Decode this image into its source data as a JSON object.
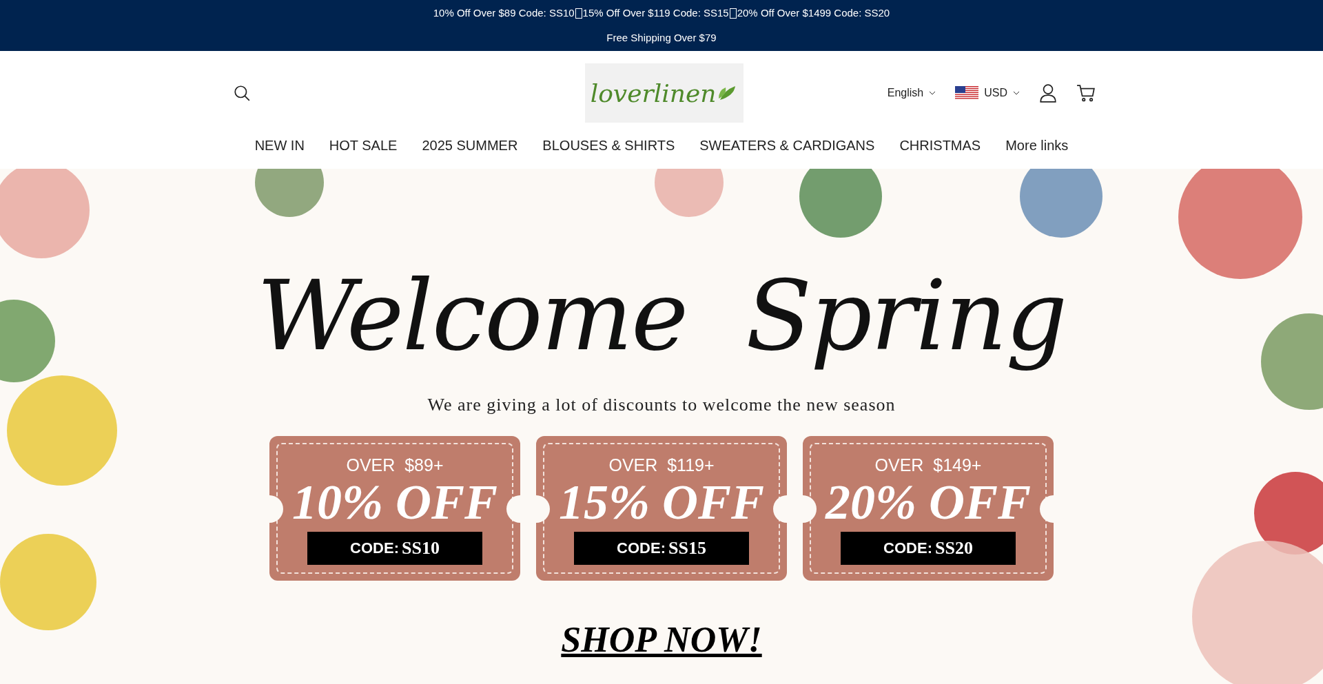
{
  "announcement": {
    "promos": [
      "10% Off Over $89 Code: SS10",
      "15% Off Over $119 Code: SS15",
      "20% Off Over $1499 Code: SS20"
    ],
    "shipping": "Free Shipping Over $79"
  },
  "header": {
    "logo": "loverlinen",
    "language": "English",
    "currency": "USD"
  },
  "nav": [
    "NEW IN",
    "HOT SALE",
    "2025 SUMMER",
    "BLOUSES & SHIRTS",
    "SWEATERS & CARDIGANS",
    "CHRISTMAS",
    "More links"
  ],
  "hero": {
    "title": "Welcome  Spring",
    "subtitle": "We are giving a lot of discounts to welcome the new season",
    "coupons": [
      {
        "threshold": "OVER  $89+",
        "discount": "10% OFF",
        "code_label": "CODE:",
        "code": "SS10"
      },
      {
        "threshold": "OVER  $119+",
        "discount": "15% OFF",
        "code_label": "CODE:",
        "code": "SS15"
      },
      {
        "threshold": "OVER  $149+",
        "discount": "20% OFF",
        "code_label": "CODE:",
        "code": "SS20"
      }
    ],
    "cta": "SHOP NOW!"
  }
}
